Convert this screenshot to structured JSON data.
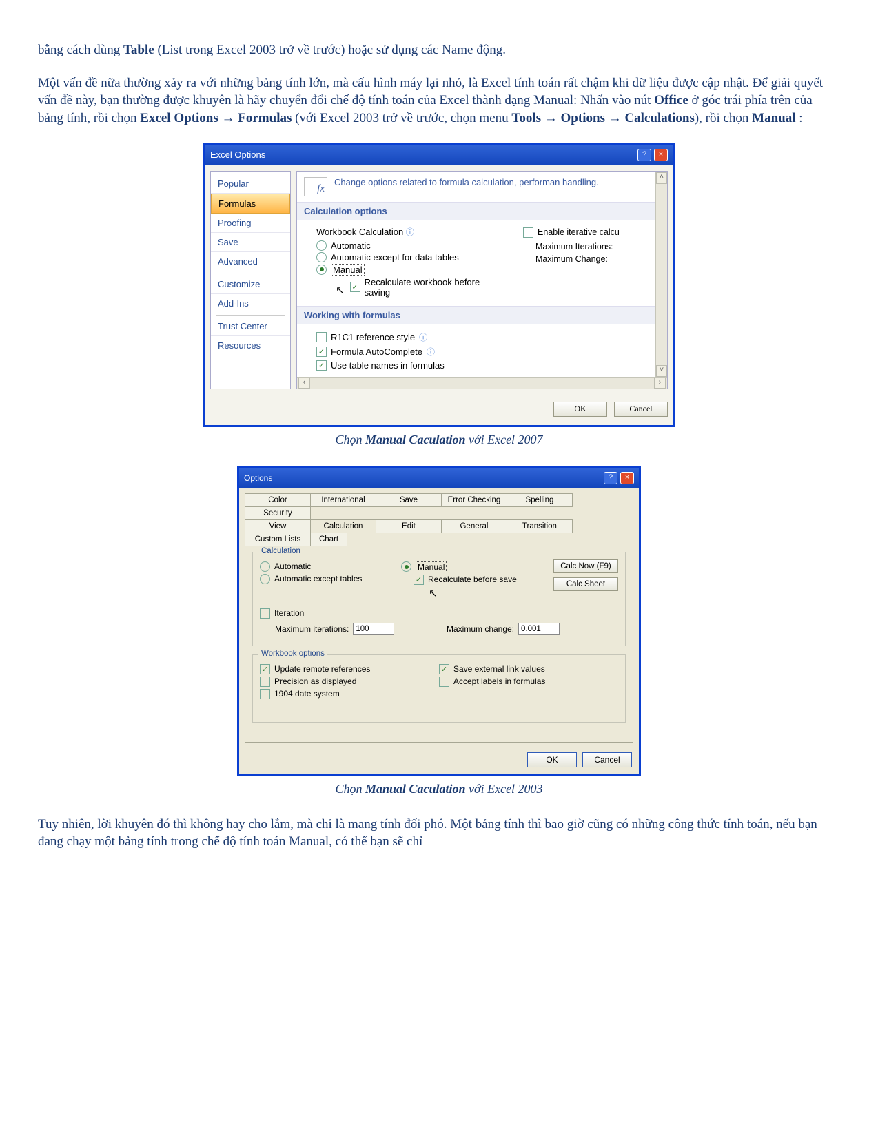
{
  "para1_a": "bằng cách dùng ",
  "para1_b": "Table",
  "para1_c": " (List trong Excel 2003 trở về trước) hoặc sử dụng các Name động.",
  "para2_a": "Một vấn đề nữa thường xảy ra với những bảng tính lớn, mà cấu hình máy lại nhỏ, là Excel tính toán rất chậm khi dữ liệu được cập nhật. Để giải quyết vấn đề này, bạn thường được khuyên là hãy chuyển đổi chế độ tính toán của Excel thành dạng Manual: Nhấn vào nút ",
  "para2_b": "Office",
  "para2_c": " ở góc trái phía trên của bảng tính, rồi chọn ",
  "para2_d": "Excel Options",
  "para2_e": " → ",
  "para2_f": "Formulas",
  "para2_g": " (với Excel 2003 trở về trước, chọn menu ",
  "para2_h": "Tools",
  "para2_i": " → ",
  "para2_j": "Options",
  "para2_k": " → ",
  "para2_l": "Calculations",
  "para2_m": "), rồi chọn ",
  "para2_n": "Manual",
  "para2_o": " :",
  "dlg07": {
    "title": "Excel Options",
    "nav": {
      "popular": "Popular",
      "formulas": "Formulas",
      "proofing": "Proofing",
      "save": "Save",
      "advanced": "Advanced",
      "customize": "Customize",
      "addins": "Add-Ins",
      "trust": "Trust Center",
      "resources": "Resources"
    },
    "header": "Change options related to formula calculation, performan handling.",
    "sec1": "Calculation options",
    "wbcalc": "Workbook Calculation",
    "r_auto": "Automatic",
    "r_autox": "Automatic except for data tables",
    "r_manual": "Manual",
    "recalc": "Recalculate workbook before saving",
    "enable_iter": "Enable iterative calcu",
    "max_iter": "Maximum Iterations:",
    "max_chg": "Maximum Change:",
    "sec2": "Working with formulas",
    "r1c1": "R1C1 reference style",
    "autoc": "Formula AutoComplete",
    "tblnames": "Use table names in formulas",
    "ok": "OK",
    "cancel": "Cancel"
  },
  "cap1_a": "Chọn ",
  "cap1_b": "Manual Caculation",
  "cap1_c": " với Excel 2007",
  "dlg03": {
    "title": "Options",
    "tabs": {
      "color": "Color",
      "intl": "International",
      "save": "Save",
      "err": "Error Checking",
      "spell": "Spelling",
      "sec": "Security",
      "view": "View",
      "calc": "Calculation",
      "edit": "Edit",
      "gen": "General",
      "trans": "Transition",
      "cust": "Custom Lists",
      "chart": "Chart"
    },
    "grp_calc": "Calculation",
    "r_auto": "Automatic",
    "r_autox": "Automatic except tables",
    "r_manual": "Manual",
    "recalc": "Recalculate before save",
    "calc_now": "Calc Now (F9)",
    "calc_sheet": "Calc Sheet",
    "iter": "Iteration",
    "max_iter_l": "Maximum iterations:",
    "max_iter_v": "100",
    "max_chg_l": "Maximum change:",
    "max_chg_v": "0.001",
    "grp_wb": "Workbook options",
    "upd": "Update remote references",
    "save_ext": "Save external link values",
    "prec": "Precision as displayed",
    "accept": "Accept labels in formulas",
    "d1904": "1904 date system",
    "ok": "OK",
    "cancel": "Cancel"
  },
  "cap2_a": "Chọn ",
  "cap2_b": "Manual Caculation",
  "cap2_c": " với Excel 2003",
  "para3": "Tuy nhiên, lời khuyên đó thì không hay cho lắm, mà chỉ là mang tính đối phó. Một bảng tính thì bao giờ cũng có những công thức tính toán, nếu bạn đang chạy một bảng tính trong chế độ tính toán Manual, có thể bạn sẽ chỉ"
}
